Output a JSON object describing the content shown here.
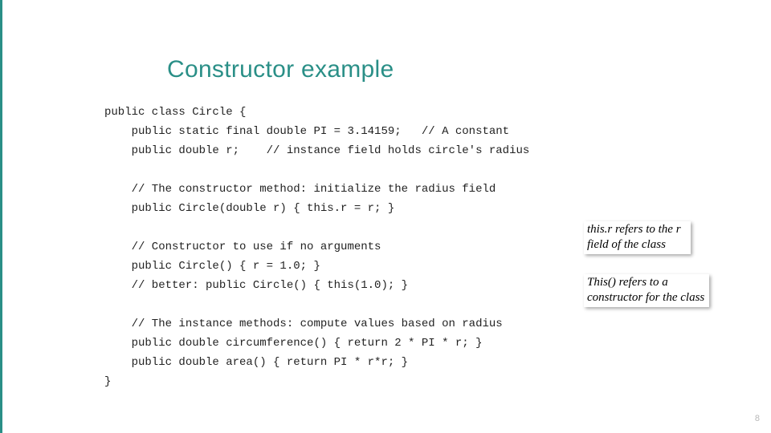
{
  "slide": {
    "title": "Constructor example",
    "pageNumber": "8"
  },
  "code": {
    "l1": "public class Circle {",
    "l2": "    public static final double PI = 3.14159;   // A constant",
    "l3": "    public double r;    // instance field holds circle's radius",
    "l4": "",
    "l5": "    // The constructor method: initialize the radius field",
    "l6": "    public Circle(double r) { this.r = r; }",
    "l7": "",
    "l8": "    // Constructor to use if no arguments",
    "l9": "    public Circle() { r = 1.0; }",
    "l10": "    // better: public Circle() { this(1.0); }",
    "l11": "",
    "l12": "    // The instance methods: compute values based on radius",
    "l13": "    public double circumference() { return 2 * PI * r; }",
    "l14": "    public double area() { return PI * r*r; }",
    "l15": "}"
  },
  "notes": {
    "n1": "this.r refers to the r field of the class",
    "n2": "This() refers to a constructor for the class"
  }
}
